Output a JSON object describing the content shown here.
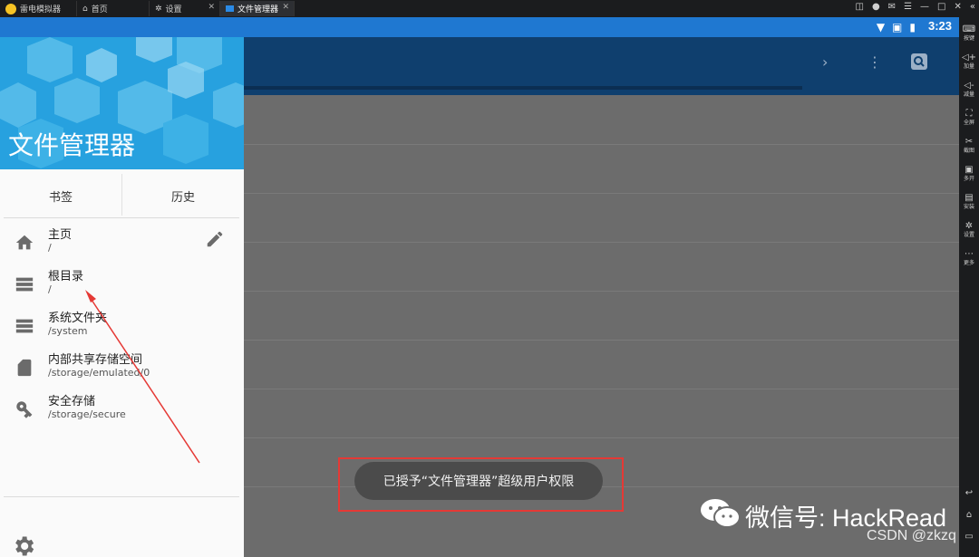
{
  "emulator": {
    "tabs": [
      {
        "label": "雷电模拟器"
      },
      {
        "label": "首页"
      },
      {
        "label": "设置"
      },
      {
        "label": "文件管理器"
      }
    ],
    "sidebar": [
      {
        "label": "按键",
        "icon": "keyboard-icon"
      },
      {
        "label": "加量",
        "icon": "volume-up-icon"
      },
      {
        "label": "减量",
        "icon": "volume-down-icon"
      },
      {
        "label": "全屏",
        "icon": "fullscreen-icon"
      },
      {
        "label": "截图",
        "icon": "screenshot-icon"
      },
      {
        "label": "多开",
        "icon": "multi-instance-icon"
      },
      {
        "label": "安装",
        "icon": "install-apk-icon"
      },
      {
        "label": "设置",
        "icon": "settings-icon"
      },
      {
        "label": "更多",
        "icon": "more-icon"
      }
    ]
  },
  "status": {
    "time": "3:23"
  },
  "drawer": {
    "title": "文件管理器",
    "tabs": [
      "书签",
      "历史"
    ],
    "items": [
      {
        "title": "主页",
        "path": "/",
        "icon": "home-icon"
      },
      {
        "title": "根目录",
        "path": "/",
        "icon": "storage-icon"
      },
      {
        "title": "系统文件夹",
        "path": "/system",
        "icon": "storage-icon"
      },
      {
        "title": "内部共享存储空间",
        "path": "/storage/emulated/0",
        "icon": "sd-card-icon"
      },
      {
        "title": "安全存储",
        "path": "/storage/secure",
        "icon": "key-icon"
      }
    ]
  },
  "toast": {
    "message": "已授予“文件管理器”超级用户权限"
  },
  "watermark": {
    "wechat": "微信号: HackRead",
    "csdn": "CSDN @zkzq"
  },
  "colors": {
    "status_bar": "#1f78d1",
    "app_bar": "#0f3f6e",
    "drawer_header": "#27a1df",
    "highlight": "#e53935"
  }
}
